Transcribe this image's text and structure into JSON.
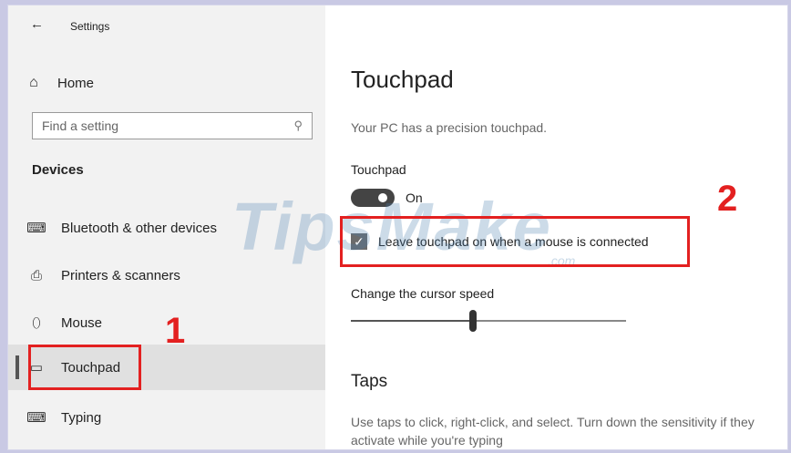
{
  "titlebar": {
    "back_icon": "←",
    "title": "Settings"
  },
  "sidebar": {
    "home": {
      "icon": "⌂",
      "label": "Home"
    },
    "search": {
      "placeholder": "Find a setting",
      "icon": "⚲"
    },
    "section_label": "Devices",
    "items": [
      {
        "icon": "⌨",
        "icon_name": "bluetooth-devices-icon",
        "label": "Bluetooth & other devices"
      },
      {
        "icon": "⎙",
        "icon_name": "printer-icon",
        "label": "Printers & scanners"
      },
      {
        "icon": "⬯",
        "icon_name": "mouse-icon",
        "label": "Mouse"
      },
      {
        "icon": "▭",
        "icon_name": "touchpad-icon",
        "label": "Touchpad",
        "active": true
      },
      {
        "icon": "⌨",
        "icon_name": "keyboard-icon",
        "label": "Typing"
      }
    ]
  },
  "content": {
    "title": "Touchpad",
    "info": "Your PC has a precision touchpad.",
    "touchpad_label": "Touchpad",
    "toggle_state": "On",
    "checkbox_label": "Leave touchpad on when a mouse is connected",
    "checkbox_checked": true,
    "speed_label": "Change the cursor speed",
    "speed_value": 0.44,
    "taps_title": "Taps",
    "taps_desc": "Use taps to click, right-click, and select. Turn down the sensitivity if they activate while you're typing"
  },
  "annotations": {
    "step1": "1",
    "step2": "2",
    "color": "#e32020"
  },
  "watermark": {
    "text": "TipsMake",
    "suffix": ".com"
  }
}
